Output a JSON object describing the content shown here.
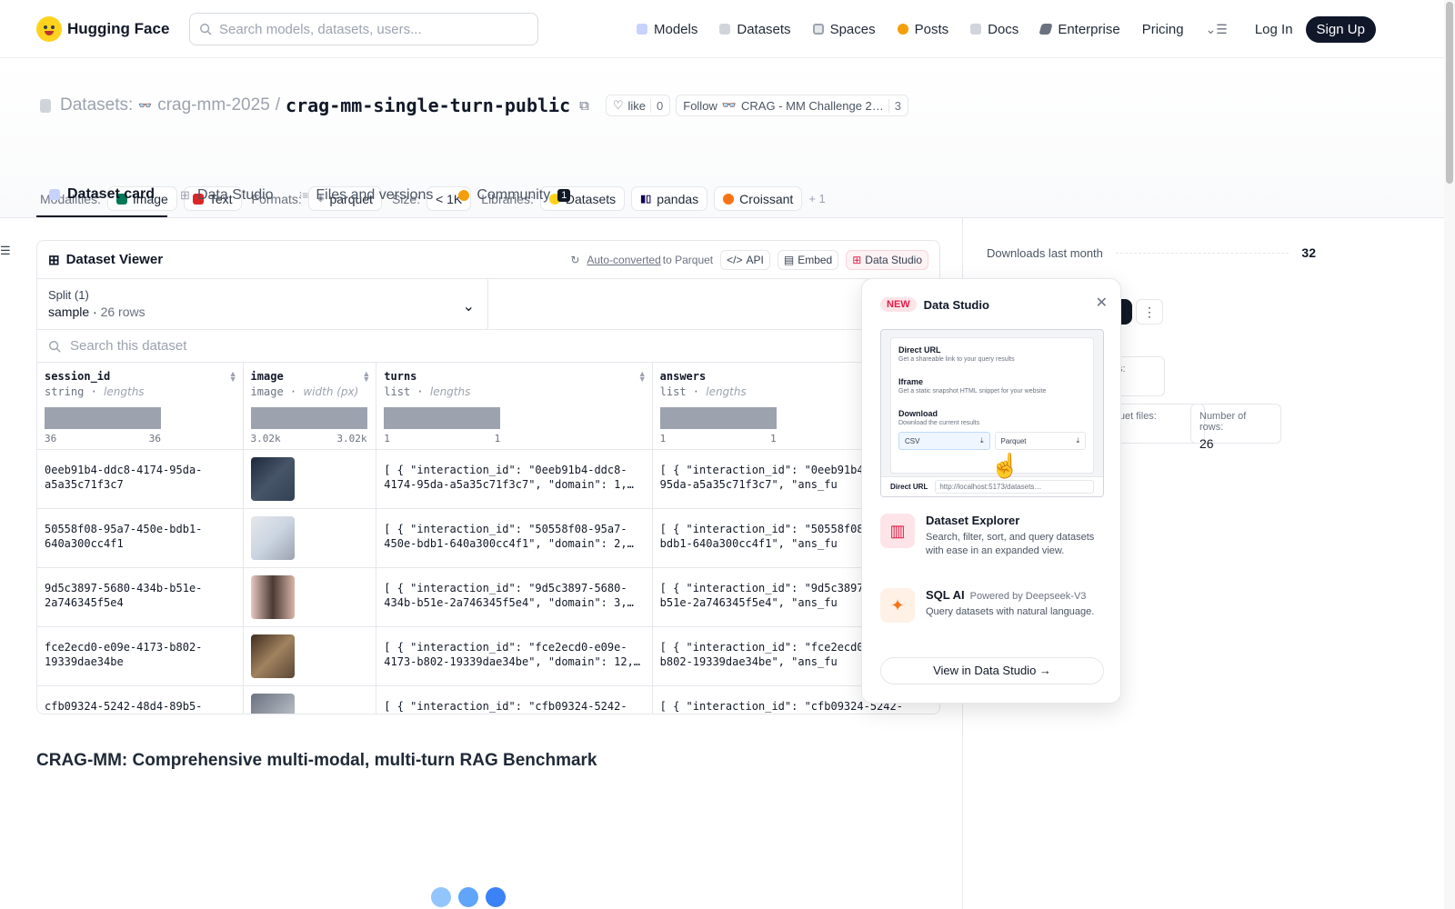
{
  "nav": {
    "brand": "Hugging Face",
    "search_placeholder": "Search models, datasets, users...",
    "links": [
      "Models",
      "Datasets",
      "Spaces",
      "Posts",
      "Docs",
      "Enterprise",
      "Pricing"
    ],
    "login": "Log In",
    "signup": "Sign Up"
  },
  "header": {
    "datasets_label": "Datasets:",
    "org": "crag-mm-2025",
    "sep": "/",
    "repo": "crag-mm-single-turn-public",
    "like_label": "like",
    "like_count": "0",
    "follow_label": "Follow",
    "follow_org": "CRAG - MM Challenge 2…",
    "follow_count": "3",
    "modalities_label": "Modalities:",
    "modalities": [
      "Image",
      "Text"
    ],
    "formats_label": "Formats:",
    "format": "parquet",
    "size_label": "Size:",
    "size": "< 1K",
    "libraries_label": "Libraries:",
    "libraries": [
      "Datasets",
      "pandas",
      "Croissant"
    ],
    "libraries_more": "+ 1"
  },
  "tabs": [
    "Dataset card",
    "Data Studio",
    "Files and versions",
    "Community"
  ],
  "community_count": "1",
  "viewer": {
    "title": "Dataset Viewer",
    "auto_converted": "Auto-converted",
    "to_parquet": "to Parquet",
    "api": "API",
    "embed": "Embed",
    "data_studio": "Data Studio",
    "split_label": "Split (1)",
    "split_value": "sample",
    "split_rows": "26 rows",
    "search_placeholder": "Search this dataset",
    "columns": [
      {
        "name": "session_id",
        "type": "string",
        "sub": "lengths",
        "min": "36",
        "max": "36"
      },
      {
        "name": "image",
        "type": "image",
        "sub": "width (px)",
        "min": "3.02k",
        "max": "3.02k"
      },
      {
        "name": "turns",
        "type": "list",
        "sub": "lengths",
        "min": "1",
        "max": "1"
      },
      {
        "name": "answers",
        "type": "list",
        "sub": "lengths",
        "min": "1",
        "max": "1"
      }
    ],
    "rows": [
      {
        "session_id": "0eeb91b4-ddc8-4174-95da-a5a35c71f3c7",
        "turns": "[ { \"interaction_id\": \"0eeb91b4-ddc8-4174-95da-a5a35c71f3c7\", \"domain\": 1,…",
        "answers": "[ { \"interaction_id\": \"0eeb91b4-4174-95da-a5a35c71f3c7\", \"ans_fu"
      },
      {
        "session_id": "50558f08-95a7-450e-bdb1-640a300cc4f1",
        "turns": "[ { \"interaction_id\": \"50558f08-95a7-450e-bdb1-640a300cc4f1\", \"domain\": 2,…",
        "answers": "[ { \"interaction_id\": \"50558f08-450e-bdb1-640a300cc4f1\", \"ans_fu"
      },
      {
        "session_id": "9d5c3897-5680-434b-b51e-2a746345f5e4",
        "turns": "[ { \"interaction_id\": \"9d5c3897-5680-434b-b51e-2a746345f5e4\", \"domain\": 3,…",
        "answers": "[ { \"interaction_id\": \"9d5c3897-434b-b51e-2a746345f5e4\", \"ans_fu"
      },
      {
        "session_id": "fce2ecd0-e09e-4173-b802-19339dae34be",
        "turns": "[ { \"interaction_id\": \"fce2ecd0-e09e-4173-b802-19339dae34be\", \"domain\": 12,…",
        "answers": "[ { \"interaction_id\": \"fce2ecd0-4173-b802-19339dae34be\", \"ans_fu"
      },
      {
        "session_id": "cfb09324-5242-48d4-89b5-",
        "turns": "[ { \"interaction_id\": \"cfb09324-5242-",
        "answers": "[ { \"interaction_id\": \"cfb09324-5242-"
      }
    ]
  },
  "card_title": "CRAG-MM: Comprehensive multi-modal, multi-turn RAG Benchmark",
  "sidebar": {
    "downloads_label": "Downloads last month",
    "downloads": "32",
    "files_label": "files:",
    "parquet_label": "arquet files:",
    "rows_label": "Number of rows:",
    "rows_value": "26"
  },
  "popup": {
    "new": "NEW",
    "title": "Data Studio",
    "preview": {
      "direct_url": "Direct URL",
      "direct_url_desc": "Get a shareable link to your query results",
      "iframe": "Iframe",
      "iframe_desc": "Get a static snapshot HTML snippet for your website",
      "download": "Download",
      "download_desc": "Download the current results",
      "csv": "CSV",
      "parquet": "Parquet",
      "bar_label": "Direct URL",
      "bar_url": "http://localhost:5173/datasets…"
    },
    "explorer_title": "Dataset Explorer",
    "explorer_desc": "Search, filter, sort, and query datasets with ease in an expanded view.",
    "sql_title": "SQL AI",
    "sql_powered": "Powered by Deepseek-V3",
    "sql_desc": "Query datasets with natural language.",
    "cta": "View in Data Studio →"
  }
}
